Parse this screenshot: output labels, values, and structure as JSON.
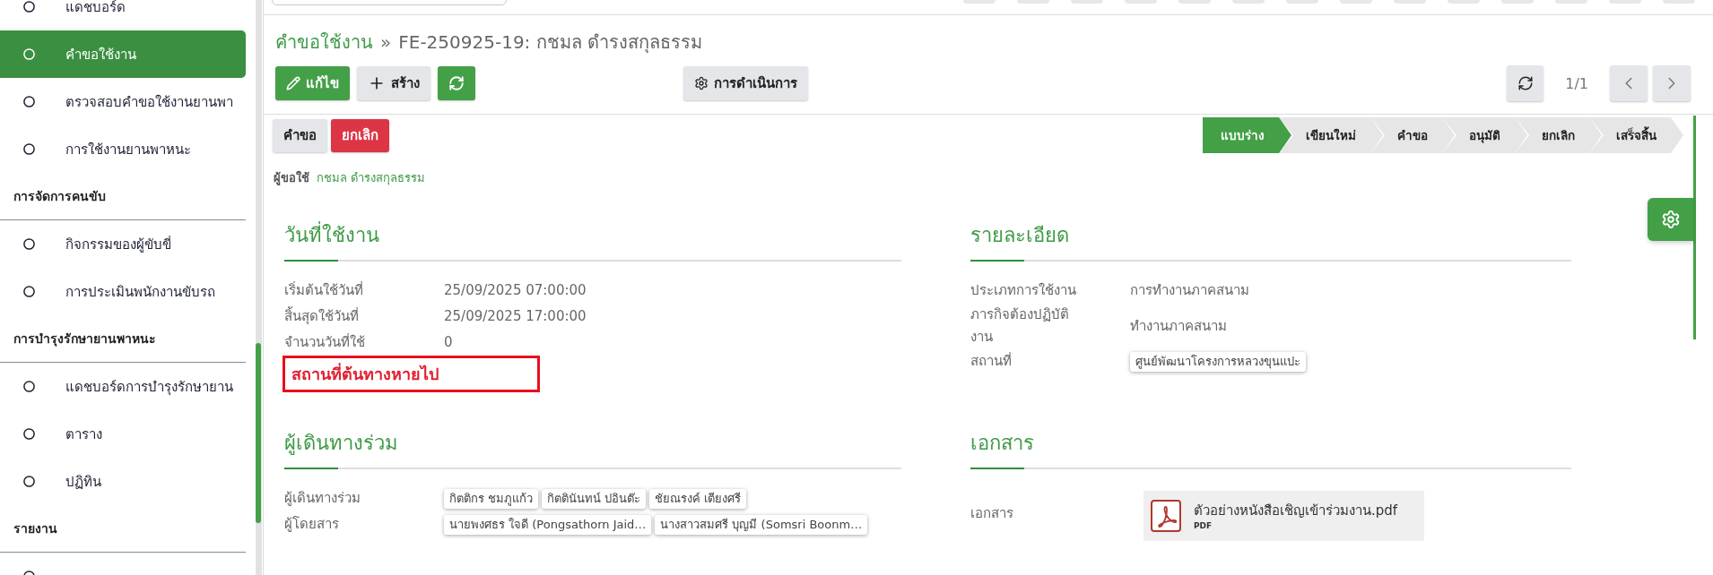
{
  "sidebar": {
    "groups": [
      {
        "items": [
          {
            "label": "แดชบอร์ด",
            "selected": false
          },
          {
            "label": "คำขอใช้งาน",
            "selected": true
          },
          {
            "label": "ตรวจสอบคำขอใช้งานยานพา",
            "selected": false
          },
          {
            "label": "การใช้งานยานพาหนะ",
            "selected": false
          }
        ]
      },
      {
        "title": "การจัดการคนขับ",
        "items": [
          {
            "label": "กิจกรรมของผู้ขับขี่",
            "selected": false
          },
          {
            "label": "การประเมินพนักงานขับรถ",
            "selected": false
          }
        ]
      },
      {
        "title": "การบำรุงรักษายานพาหนะ",
        "items": [
          {
            "label": "แดชบอร์ดการบำรุงรักษายาน",
            "selected": false
          },
          {
            "label": "ตาราง",
            "selected": false
          },
          {
            "label": "ปฏิทิน",
            "selected": false
          }
        ]
      },
      {
        "title": "รายงาน",
        "items": [
          {
            "selected": false
          }
        ]
      }
    ]
  },
  "breadcrumb": {
    "parent": "คำขอใช้งาน",
    "separator": "»",
    "current": "FE-250925-19: กชมล ดำรงสกุลธรรม"
  },
  "toolbar": {
    "edit_button": {
      "label": "แก้ไข"
    },
    "create_button": {
      "label": "สร้าง"
    },
    "action_button": {
      "label": "การดำเนินการ"
    },
    "pager": {
      "value": "1/1"
    }
  },
  "status_buttons": [
    {
      "label": "คำขอ",
      "kind": "secondary"
    },
    {
      "label": "ยกเลิก",
      "kind": "danger"
    }
  ],
  "statusbar": [
    {
      "label": "แบบร่าง",
      "selected": true
    },
    {
      "label": "เขียนใหม่",
      "selected": false
    },
    {
      "label": "คำขอ",
      "selected": false
    },
    {
      "label": "อนุมัติ",
      "selected": false
    },
    {
      "label": "ยกเลิก",
      "selected": false
    },
    {
      "label": "เสร็จสิ้น",
      "selected": false
    }
  ],
  "requester": {
    "label": "ผู้ขอใช้",
    "value": "กชมล ดำรงสกุลธรรม"
  },
  "sections": [
    {
      "title": "วันที่ใช้งาน",
      "fields": [
        {
          "label": "เริ่มต้นใช้วันที่",
          "kind": "text",
          "value": "25/09/2025 07:00:00"
        },
        {
          "label": "สิ้นสุดใช้วันที่",
          "kind": "text",
          "value": "25/09/2025 17:00:00"
        },
        {
          "label": "จำนวนวันที่ใช้",
          "kind": "text",
          "value": "0"
        }
      ],
      "warning": "สถานที่ต้นทางหายไป"
    },
    {
      "title": "รายละเอียด",
      "fields": [
        {
          "label": "ประเภทการใช้งาน",
          "kind": "text",
          "value": "การทำงานภาคสนาม"
        },
        {
          "label": "ภารกิจต้องปฏิบัติงาน",
          "kind": "text",
          "value": "ทำงานภาคสนาม"
        },
        {
          "label": "สถานที่",
          "kind": "tags",
          "tags": [
            "ศูนย์พัฒนาโครงการหลวงขุนแปะ"
          ]
        }
      ]
    },
    {
      "title": "ผู้เดินทางร่วม",
      "fields": [
        {
          "label": "ผู้เดินทางร่วม",
          "kind": "tags",
          "tags": [
            "กิตติกร ชมภูแก้ว",
            "กิตตินันทน์ ปอินต๊ะ",
            "ชัยณรงค์ เตียงศรี"
          ]
        },
        {
          "label": "ผู้โดยสาร",
          "kind": "tags",
          "tags": [
            "นายพงศธร ใจดี (Pongsathorn Jaid…",
            "นางสาวสมศรี บุญมี (Somsri Boonm…"
          ]
        }
      ]
    },
    {
      "title": "เอกสาร",
      "fields": [
        {
          "label": "เอกสาร",
          "kind": "attachment",
          "file": {
            "name": "ตัวอย่างหนังสือเชิญเข้าร่วมงาน.pdf",
            "type": "PDF"
          }
        }
      ]
    }
  ]
}
